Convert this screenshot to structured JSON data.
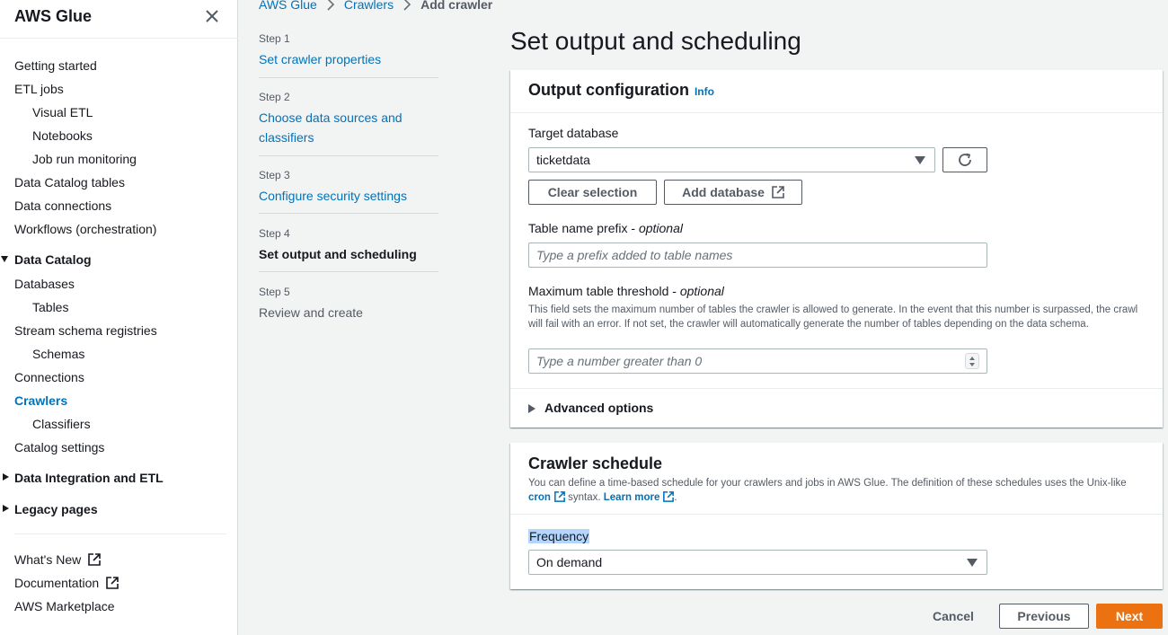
{
  "sidebar": {
    "title": "AWS Glue",
    "items": [
      {
        "label": "Getting started"
      },
      {
        "label": "ETL jobs"
      },
      {
        "label": "Visual ETL"
      },
      {
        "label": "Notebooks"
      },
      {
        "label": "Job run monitoring"
      },
      {
        "label": "Data Catalog tables"
      },
      {
        "label": "Data connections"
      },
      {
        "label": "Workflows (orchestration)"
      }
    ],
    "data_catalog": {
      "section": "Data Catalog",
      "items": [
        {
          "label": "Databases"
        },
        {
          "label": "Tables"
        },
        {
          "label": "Stream schema registries"
        },
        {
          "label": "Schemas"
        },
        {
          "label": "Connections"
        },
        {
          "label": "Crawlers"
        },
        {
          "label": "Classifiers"
        },
        {
          "label": "Catalog settings"
        }
      ]
    },
    "sections_collapsed": [
      {
        "label": "Data Integration and ETL"
      },
      {
        "label": "Legacy pages"
      }
    ],
    "footer": [
      {
        "label": "What's New"
      },
      {
        "label": "Documentation"
      },
      {
        "label": "AWS Marketplace"
      }
    ]
  },
  "breadcrumb": {
    "items": [
      "AWS Glue",
      "Crawlers"
    ],
    "current": "Add crawler"
  },
  "steps": [
    {
      "num": "Step 1",
      "label": "Set crawler properties"
    },
    {
      "num": "Step 2",
      "label": "Choose data sources and classifiers"
    },
    {
      "num": "Step 3",
      "label": "Configure security settings"
    },
    {
      "num": "Step 4",
      "label": "Set output and scheduling"
    },
    {
      "num": "Step 5",
      "label": "Review and create"
    }
  ],
  "page_title": "Set output and scheduling",
  "output_config": {
    "heading": "Output configuration",
    "info": "Info",
    "target_db_label": "Target database",
    "target_db_value": "ticketdata",
    "clear_selection": "Clear selection",
    "add_database": "Add database",
    "prefix_label": "Table name prefix - ",
    "prefix_optional": "optional",
    "prefix_placeholder": "Type a prefix added to table names",
    "threshold_label": "Maximum table threshold - ",
    "threshold_optional": "optional",
    "threshold_desc": "This field sets the maximum number of tables the crawler is allowed to generate. In the event that this number is surpassed, the crawl will fail with an error. If not set, the crawler will automatically generate the number of tables depending on the data schema.",
    "threshold_placeholder": "Type a number greater than 0",
    "advanced": "Advanced options"
  },
  "schedule": {
    "heading": "Crawler schedule",
    "desc_1": "You can define a time-based schedule for your crawlers and jobs in AWS Glue. The definition of these schedules uses the Unix-like",
    "cron": "cron",
    "desc_2": "syntax.",
    "learn_more": "Learn more",
    "desc_3": ".",
    "frequency_label": "Frequency",
    "frequency_value": "On demand"
  },
  "footer": {
    "cancel": "Cancel",
    "previous": "Previous",
    "next": "Next"
  },
  "colors": {
    "link": "#0073bb",
    "primary": "#ec7211",
    "background": "#f2f3f3"
  }
}
